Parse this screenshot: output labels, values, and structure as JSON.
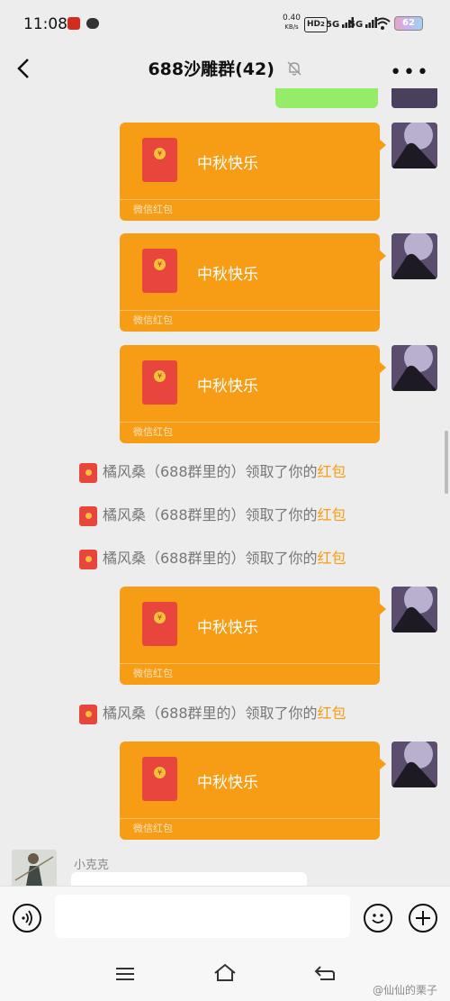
{
  "status_bar": {
    "time": "11:08",
    "net_speed_value": "0.40",
    "net_speed_unit": "KB/s",
    "hd": "HD",
    "hd_sub": "2",
    "sim1": "5G",
    "sim2": "5G",
    "battery": "62"
  },
  "header": {
    "title": "688沙雕群(42)",
    "more": "•••"
  },
  "red_packets": [
    {
      "greeting": "中秋快乐",
      "footer": "微信红包",
      "coin": "¥"
    },
    {
      "greeting": "中秋快乐",
      "footer": "微信红包",
      "coin": "¥"
    },
    {
      "greeting": "中秋快乐",
      "footer": "微信红包",
      "coin": "¥"
    },
    {
      "greeting": "中秋快乐",
      "footer": "微信红包",
      "coin": "¥"
    },
    {
      "greeting": "中秋快乐",
      "footer": "微信红包",
      "coin": "¥"
    }
  ],
  "system_messages": [
    {
      "text": "橘风桑（688群里的）领取了你的",
      "highlight": "红包"
    },
    {
      "text": "橘风桑（688群里的）领取了你的",
      "highlight": "红包"
    },
    {
      "text": "橘风桑（688群里的）领取了你的",
      "highlight": "红包"
    },
    {
      "text": "橘风桑（688群里的）领取了你的",
      "highlight": "红包"
    }
  ],
  "other_user": {
    "name": "小克克"
  },
  "input": {
    "value": "",
    "placeholder": ""
  },
  "watermark": "@仙仙的栗子",
  "colors": {
    "accent": "#f79c15",
    "envelope": "#e8453c",
    "chat_bg": "#ededed",
    "self_bubble": "#95ec69"
  }
}
